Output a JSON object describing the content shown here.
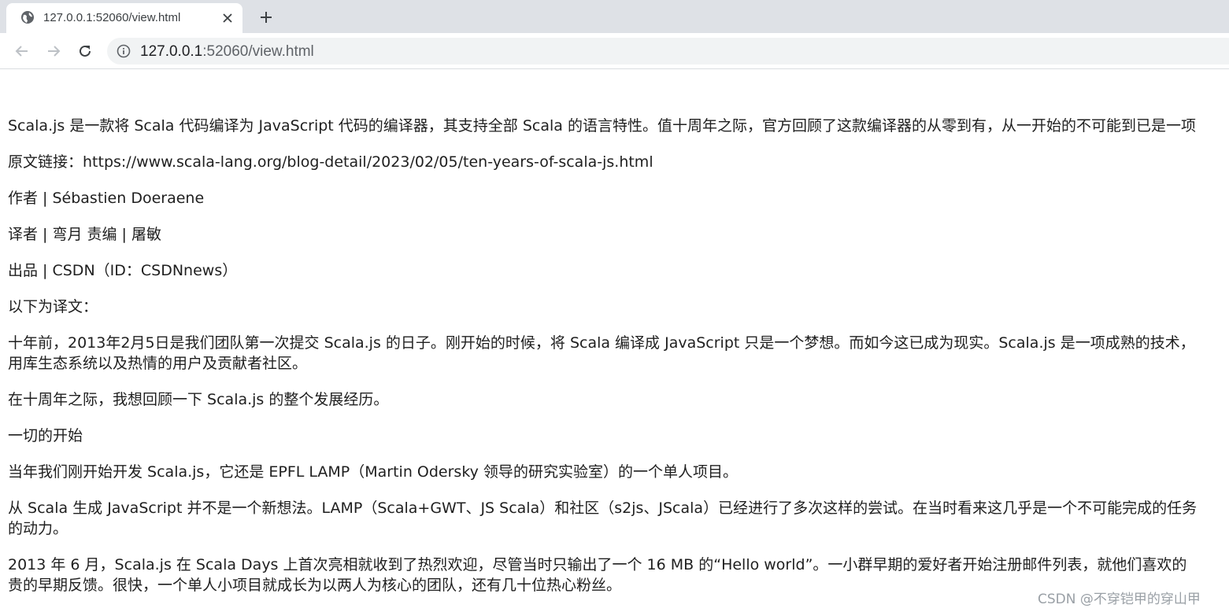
{
  "browser": {
    "tab": {
      "title": "127.0.0.1:52060/view.html",
      "favicon": "globe-icon"
    },
    "new_tab_label": "+",
    "omnibox": {
      "url_host": "127.0.0.1",
      "url_rest": ":52060/view.html"
    },
    "icons": {
      "back": "arrow-left-icon",
      "forward": "arrow-right-icon",
      "reload": "reload-icon",
      "info": "info-icon",
      "close": "close-icon"
    }
  },
  "article": {
    "intro": "Scala.js 是一款将 Scala 代码编译为 JavaScript 代码的编译器，其支持全部 Scala 的语言特性。值十周年之际，官方回顾了这款编译器的从零到有，从一开始的不可能到已是一项",
    "source_link": "原文链接：https://www.scala-lang.org/blog-detail/2023/02/05/ten-years-of-scala-js.html",
    "author": "作者 | Sébastien Doeraene",
    "translator": "译者 | 弯月   责编 | 屠敏",
    "publisher": "出品 | CSDN（ID：CSDNnews）",
    "translation_intro": "以下为译文：",
    "para1_line1": "十年前，2013年2月5日是我们团队第一次提交 Scala.js 的日子。刚开始的时候，将 Scala 编译成 JavaScript 只是一个梦想。而如今这已成为现实。Scala.js 是一项成熟的技术，",
    "para1_line2": "用库生态系统以及热情的用户及贡献者社区。",
    "para2": "在十周年之际，我想回顾一下 Scala.js 的整个发展经历。",
    "heading1": "一切的开始",
    "para3": "当年我们刚开始开发 Scala.js，它还是 EPFL LAMP（Martin Odersky 领导的研究实验室）的一个单人项目。",
    "para4_line1": "从 Scala 生成 JavaScript 并不是一个新想法。LAMP（Scala+GWT、JS Scala）和社区（s2js、JScala）已经进行了多次这样的尝试。在当时看来这几乎是一个不可能完成的任务",
    "para4_line2": "的动力。",
    "para5_line1": "2013 年 6 月，Scala.js 在 Scala Days 上首次亮相就收到了热烈欢迎，尽管当时只输出了一个 16 MB 的“Hello world”。一小群早期的爱好者开始注册邮件列表，就他们喜欢的",
    "para5_line2": "贵的早期反馈。很快，一个单人小项目就成长为以两人为核心的团队，还有几十位热心粉丝。"
  },
  "watermark": "CSDN @不穿铠甲的穿山甲"
}
